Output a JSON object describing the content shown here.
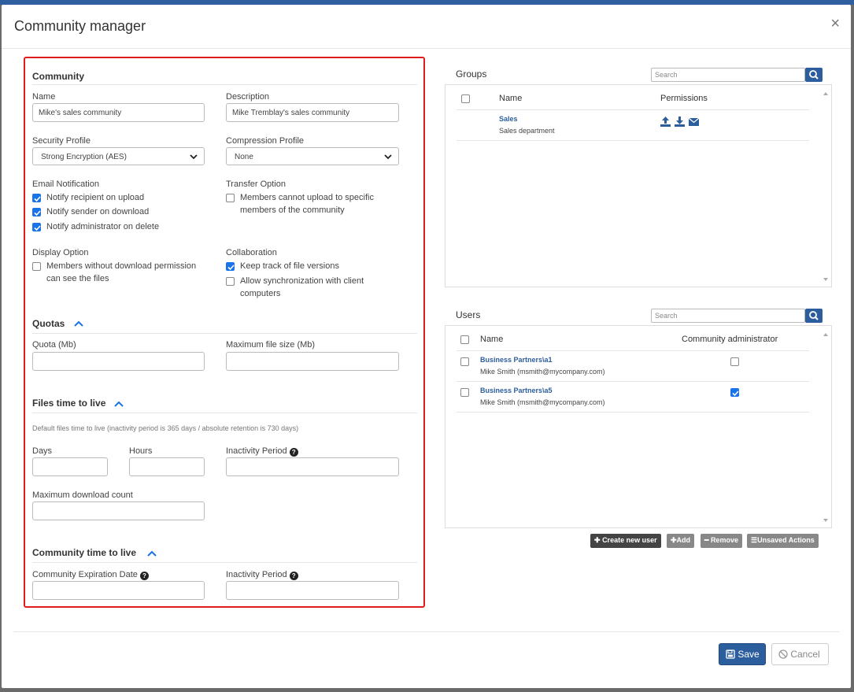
{
  "dialog": {
    "title": "Community manager",
    "close": "×"
  },
  "community": {
    "section_title": "Community",
    "name_label": "Name",
    "name_value": "Mike's sales community",
    "description_label": "Description",
    "description_value": "Mike Tremblay's sales community",
    "security_label": "Security Profile",
    "security_value": "Strong Encryption (AES)",
    "compression_label": "Compression Profile",
    "compression_value": "None",
    "email_label": "Email Notification",
    "email_options": [
      {
        "label": "Notify recipient on upload",
        "checked": true
      },
      {
        "label": "Notify sender on download",
        "checked": true
      },
      {
        "label": "Notify administrator on delete",
        "checked": true
      }
    ],
    "transfer_label": "Transfer Option",
    "transfer_option": {
      "label_line1": "Members cannot upload to specific",
      "label_line2": "members of the community",
      "checked": false
    },
    "display_label": "Display Option",
    "display_option": {
      "label_line1": "Members without download permission",
      "label_line2": "can see the files",
      "checked": false
    },
    "collab_label": "Collaboration",
    "collab_options": [
      {
        "label_line1": "Keep track of file versions",
        "label_line2": "",
        "checked": true
      },
      {
        "label_line1": "Allow synchronization with client",
        "label_line2": "computers",
        "checked": false
      }
    ]
  },
  "quotas": {
    "section_title": "Quotas",
    "quota_label": "Quota (Mb)",
    "quota_value": "",
    "max_size_label": "Maximum file size (Mb)",
    "max_size_value": ""
  },
  "files_ttl": {
    "section_title": "Files time to live",
    "hint": "Default files time to live (inactivity period is 365 days / absolute retention is 730 days)",
    "days_label": "Days",
    "hours_label": "Hours",
    "inactivity_label": "Inactivity Period",
    "max_download_label": "Maximum download count"
  },
  "community_ttl": {
    "section_title": "Community time to live",
    "expiration_label": "Community Expiration Date",
    "inactivity_label": "Inactivity Period"
  },
  "groups": {
    "title": "Groups",
    "search_placeholder": "Search",
    "col_name": "Name",
    "col_permissions": "Permissions",
    "rows": [
      {
        "name": "Sales",
        "description": "Sales department",
        "permissions": [
          "upload-icon",
          "download-icon",
          "envelope-icon"
        ]
      }
    ]
  },
  "users": {
    "title": "Users",
    "search_placeholder": "Search",
    "col_name": "Name",
    "col_admin": "Community administrator",
    "rows": [
      {
        "name": "Business Partners\\a1",
        "email": "Mike Smith (msmith@mycompany.com)",
        "admin": false
      },
      {
        "name": "Business Partners\\a5",
        "email": "Mike Smith (msmith@mycompany.com)",
        "admin": true
      }
    ],
    "buttons": {
      "create": "Create new user",
      "add": "Add",
      "remove": "Remove",
      "unsaved": "Unsaved Actions"
    }
  },
  "footer": {
    "save": "Save",
    "cancel": "Cancel"
  },
  "colors": {
    "primary": "#2c5e9e",
    "highlight_border": "#e01d1d",
    "checkbox_on": "#1a73e8"
  }
}
